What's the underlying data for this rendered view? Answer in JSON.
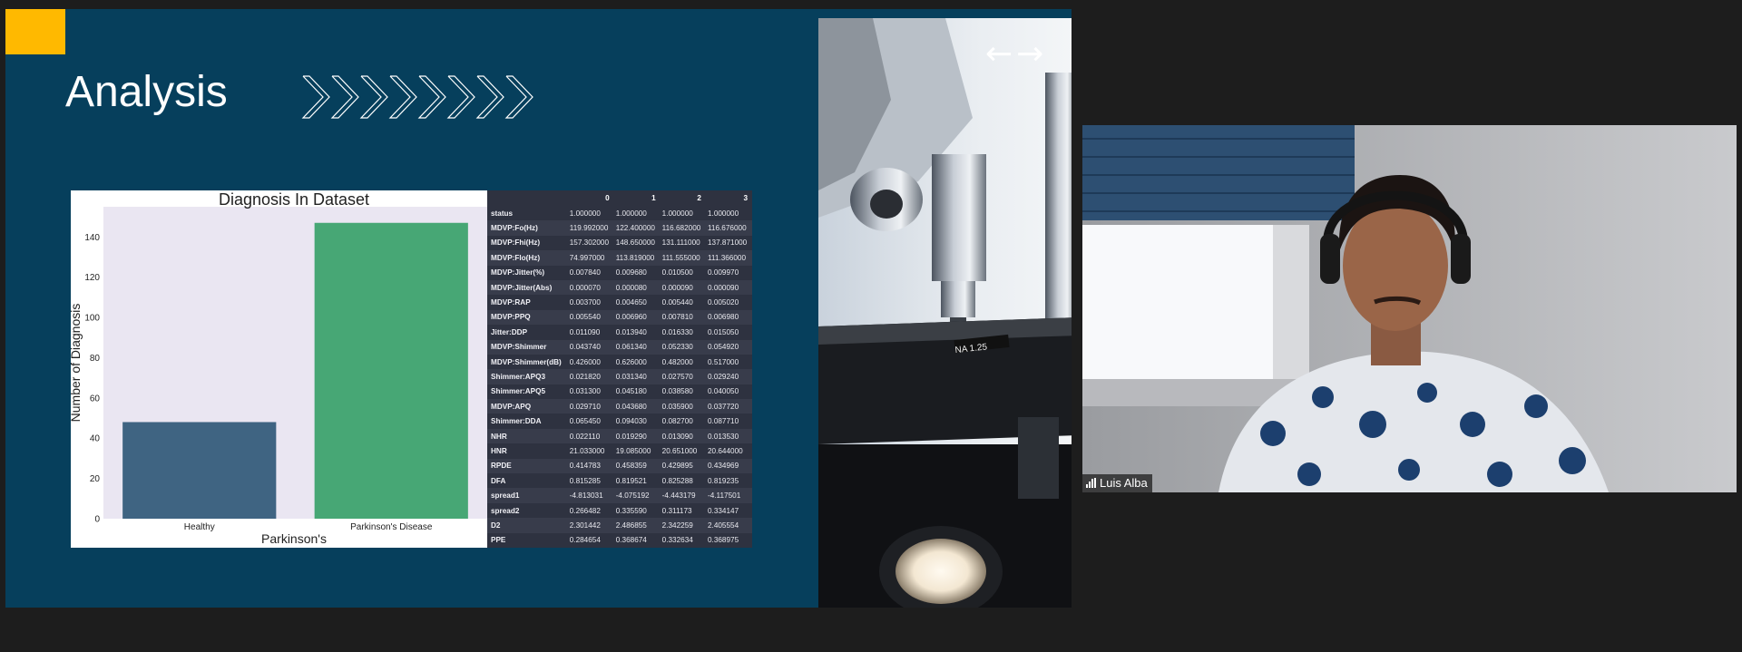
{
  "slide": {
    "title": "Analysis",
    "accent_color": "#ffb900",
    "background_color": "#063f5c"
  },
  "chart_data": {
    "type": "bar",
    "title": "Diagnosis In Dataset",
    "xlabel": "Parkinson's",
    "ylabel": "Number of Diagnosis",
    "categories": [
      "Healthy",
      "Parkinson's Disease"
    ],
    "values": [
      48,
      147
    ],
    "colors": [
      "#3f6482",
      "#47a775"
    ],
    "yticks": [
      0,
      20,
      40,
      60,
      80,
      100,
      120,
      140
    ],
    "ylim": [
      0,
      155
    ],
    "grid": false,
    "plot_background": "#eae6f2"
  },
  "table": {
    "columns": [
      "",
      "0",
      "1",
      "2",
      "3"
    ],
    "rows": [
      [
        "status",
        "1.000000",
        "1.000000",
        "1.000000",
        "1.000000"
      ],
      [
        "MDVP:Fo(Hz)",
        "119.992000",
        "122.400000",
        "116.682000",
        "116.676000"
      ],
      [
        "MDVP:Fhi(Hz)",
        "157.302000",
        "148.650000",
        "131.111000",
        "137.871000"
      ],
      [
        "MDVP:Flo(Hz)",
        "74.997000",
        "113.819000",
        "111.555000",
        "111.366000"
      ],
      [
        "MDVP:Jitter(%)",
        "0.007840",
        "0.009680",
        "0.010500",
        "0.009970"
      ],
      [
        "MDVP:Jitter(Abs)",
        "0.000070",
        "0.000080",
        "0.000090",
        "0.000090"
      ],
      [
        "MDVP:RAP",
        "0.003700",
        "0.004650",
        "0.005440",
        "0.005020"
      ],
      [
        "MDVP:PPQ",
        "0.005540",
        "0.006960",
        "0.007810",
        "0.006980"
      ],
      [
        "Jitter:DDP",
        "0.011090",
        "0.013940",
        "0.016330",
        "0.015050"
      ],
      [
        "MDVP:Shimmer",
        "0.043740",
        "0.061340",
        "0.052330",
        "0.054920"
      ],
      [
        "MDVP:Shimmer(dB)",
        "0.426000",
        "0.626000",
        "0.482000",
        "0.517000"
      ],
      [
        "Shimmer:APQ3",
        "0.021820",
        "0.031340",
        "0.027570",
        "0.029240"
      ],
      [
        "Shimmer:APQ5",
        "0.031300",
        "0.045180",
        "0.038580",
        "0.040050"
      ],
      [
        "MDVP:APQ",
        "0.029710",
        "0.043680",
        "0.035900",
        "0.037720"
      ],
      [
        "Shimmer:DDA",
        "0.065450",
        "0.094030",
        "0.082700",
        "0.087710"
      ],
      [
        "NHR",
        "0.022110",
        "0.019290",
        "0.013090",
        "0.013530"
      ],
      [
        "HNR",
        "21.033000",
        "19.085000",
        "20.651000",
        "20.644000"
      ],
      [
        "RPDE",
        "0.414783",
        "0.458359",
        "0.429895",
        "0.434969"
      ],
      [
        "DFA",
        "0.815285",
        "0.819521",
        "0.825288",
        "0.819235"
      ],
      [
        "spread1",
        "-4.813031",
        "-4.075192",
        "-4.443179",
        "-4.117501"
      ],
      [
        "spread2",
        "0.266482",
        "0.335590",
        "0.311173",
        "0.334147"
      ],
      [
        "D2",
        "2.301442",
        "2.486855",
        "2.342259",
        "2.405554"
      ],
      [
        "PPE",
        "0.284654",
        "0.368674",
        "0.332634",
        "0.368975"
      ]
    ]
  },
  "navigation": {
    "prev_icon": "arrow-left-icon",
    "next_icon": "arrow-right-icon",
    "prev_glyph": "←",
    "next_glyph": "→"
  },
  "participant": {
    "name": "Luis Alba",
    "signal_icon": "signal-strength-icon"
  }
}
